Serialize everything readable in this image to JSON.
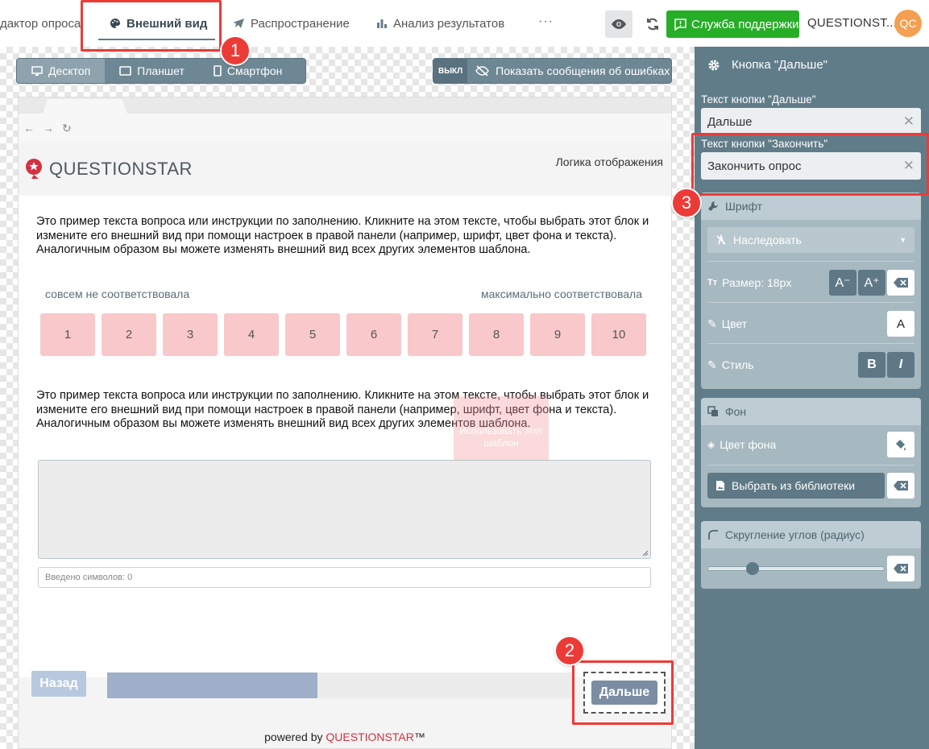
{
  "topbar": {
    "tabs": [
      {
        "label": "дактор опроса"
      },
      {
        "label": "Внешний вид"
      },
      {
        "label": "Распространение"
      },
      {
        "label": "Анализ результатов"
      }
    ],
    "more": "···",
    "support_label": "Служба поддержки",
    "brand": "QUESTIONST...",
    "avatar": "QC"
  },
  "devices": {
    "desktop": "Десктоп",
    "tablet": "Планшет",
    "phone": "Смартфон"
  },
  "errors_toggle": {
    "state": "ВЫКЛ",
    "label": "Показать сообщения об ошибках"
  },
  "survey": {
    "logo": "QUESTIONSTAR",
    "logic": "Логика отображения",
    "question1": "Это пример текста вопроса или инструкции по заполнению. Кликните на этом тексте, чтобы выбрать этот блок и измените его внешний вид при помощи настроек в правой панели (например, шрифт, цвет фона и текста). Аналогичным образом вы можете изменять внешний вид всех других элементов шаблона.",
    "scale_left": "совсем не соответствовала",
    "scale_right": "максимально соответствовала",
    "scale": [
      "1",
      "2",
      "3",
      "4",
      "5",
      "6",
      "7",
      "8",
      "9",
      "10"
    ],
    "question2": "Это пример текста вопроса или инструкции по заполнению. Кликните на этом тексте, чтобы выбрать этот блок и измените его внешний вид при помощи настроек в правой панели (например, шрифт, цвет фона и текста). Аналогичным образом вы можете изменять внешний вид всех других элементов шаблона.",
    "template_hint": "Использовать этот шаблон",
    "char_count": "Введено символов: 0",
    "back": "Назад",
    "next": "Дальше",
    "progress": 0.45,
    "powered_prefix": "powered by ",
    "powered_brand": "QUESTIONSTAR",
    "powered_tm": "™"
  },
  "panel": {
    "title": "Кнопка \"Дальше\"",
    "next_text_label": "Текст кнопки \"Дальше\"",
    "next_text_value": "Дальше",
    "finish_text_label": "Текст кнопки \"Закончить\"",
    "finish_text_value": "Закончить опрос",
    "font": {
      "title": "Шрифт",
      "family": "Наследовать",
      "size_label": "Размер: 18px",
      "dec": "A⁻",
      "inc": "A⁺",
      "color_label": "Цвет",
      "color_glyph": "A",
      "style_label": "Стиль",
      "bold": "B",
      "italic": "I"
    },
    "background": {
      "title": "Фон",
      "color_label": "Цвет фона",
      "library_label": "Выбрать из библиотеки"
    },
    "radius": {
      "title": "Скругление углов (радиус)",
      "value": 0.25
    }
  },
  "callouts": [
    "1",
    "2",
    "3"
  ],
  "colors": {
    "accent": "#27ae27",
    "highlight": "#ec3b37",
    "panel": "#617c89",
    "scale": "#f9c8cb",
    "brand_red": "#d63140"
  }
}
